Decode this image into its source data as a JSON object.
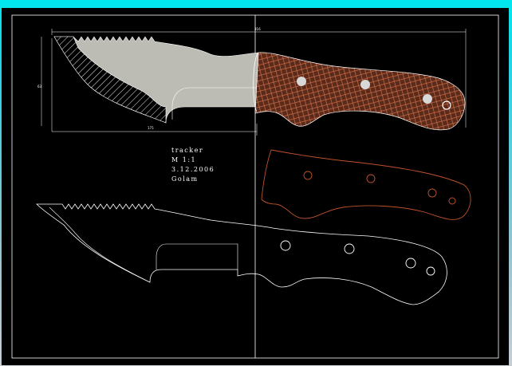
{
  "title_block": {
    "name": "tracker",
    "scale": "M 1:1",
    "date": "3.12.2006",
    "author": "Golam"
  },
  "dimensions": {
    "overall_length": "316",
    "blade_length": "175",
    "height": "63"
  },
  "colors": {
    "background": "#000000",
    "lines": "#ffffff",
    "blade_fill": "#bcbcb4",
    "handle_fill": "#5a2a1a",
    "handle_mesh": "#c8643a",
    "scale_outline": "#c0522c",
    "frame_top": "#00e8f0"
  },
  "views": [
    "blade-view-filled",
    "handle-scale-outline",
    "blade-outline-view"
  ]
}
